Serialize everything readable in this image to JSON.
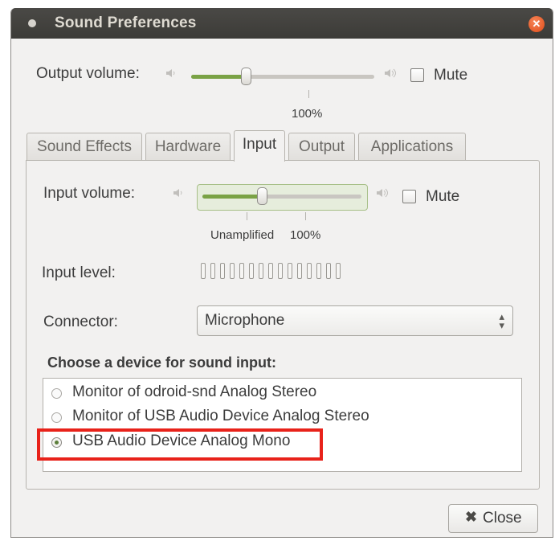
{
  "window": {
    "title": "Sound Preferences"
  },
  "output": {
    "label": "Output volume:",
    "mute_label": "Mute",
    "mute_checked": false,
    "volume_fraction": 0.3,
    "tick_label": "100%"
  },
  "tabs": [
    "Sound Effects",
    "Hardware",
    "Input",
    "Output",
    "Applications"
  ],
  "active_tab": "Input",
  "input": {
    "volume_label": "Input volume:",
    "mute_label": "Mute",
    "mute_checked": false,
    "volume_fraction": 0.375,
    "tick_unamplified": "Unamplified",
    "tick_100": "100%",
    "level_label": "Input level:",
    "level_fraction": 0
  },
  "connector": {
    "label": "Connector:",
    "value": "Microphone"
  },
  "devices": {
    "heading": "Choose a device for sound input:",
    "items": [
      {
        "label": "Monitor of odroid-snd Analog Stereo",
        "selected": false
      },
      {
        "label": "Monitor of USB Audio Device Analog Stereo",
        "selected": false
      },
      {
        "label": "USB Audio Device Analog Mono",
        "selected": true
      }
    ]
  },
  "buttons": {
    "close_label": "Close"
  },
  "colors": {
    "highlight": "#e8221a",
    "slider_fill": "#7aa245",
    "title_close": "#df4a16"
  },
  "icons": [
    "window-menu-icon",
    "close-window-icon",
    "speaker-low-icon",
    "speaker-high-icon",
    "chevron-updown-icon",
    "close-icon"
  ]
}
